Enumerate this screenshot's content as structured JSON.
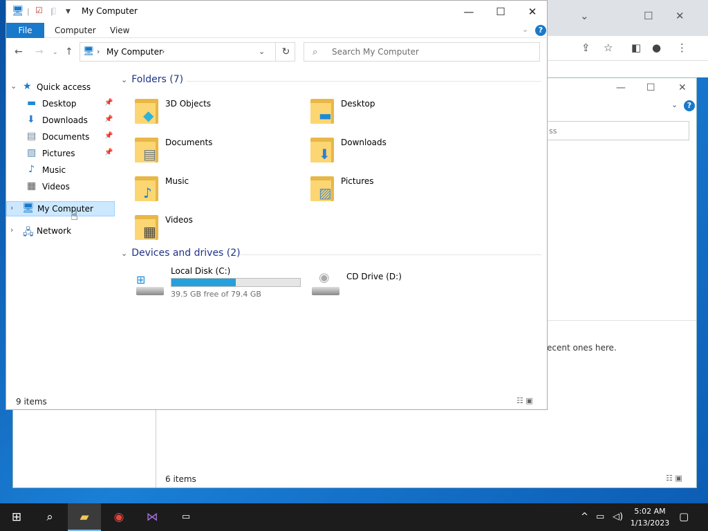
{
  "window": {
    "title": "My Computer",
    "qat_icons": [
      "computer-icon",
      "properties-icon",
      "new-folder-icon",
      "qat-dropdown-icon"
    ]
  },
  "ribbon": {
    "file": "File",
    "tabs": [
      "Computer",
      "View"
    ],
    "help": "?"
  },
  "navbar": {
    "address": "My Computer",
    "search_placeholder": "Search My Computer"
  },
  "nav": {
    "quick_access": "Quick access",
    "items": [
      {
        "label": "Desktop",
        "pinned": true
      },
      {
        "label": "Downloads",
        "pinned": true
      },
      {
        "label": "Documents",
        "pinned": true
      },
      {
        "label": "Pictures",
        "pinned": true
      },
      {
        "label": "Music",
        "pinned": false
      },
      {
        "label": "Videos",
        "pinned": false
      }
    ],
    "my_computer": "My Computer",
    "network": "Network"
  },
  "content": {
    "folders_header": "Folders (7)",
    "folders": [
      {
        "name": "3D Objects"
      },
      {
        "name": "Desktop"
      },
      {
        "name": "Documents"
      },
      {
        "name": "Downloads"
      },
      {
        "name": "Music"
      },
      {
        "name": "Pictures"
      },
      {
        "name": "Videos"
      }
    ],
    "drives_header": "Devices and drives (2)",
    "drives": [
      {
        "name": "Local Disk (C:)",
        "free": "39.5 GB free of 79.4 GB",
        "used_fraction": 0.5
      },
      {
        "name": "CD Drive (D:)"
      }
    ]
  },
  "status": {
    "items": "9 items"
  },
  "background_window": {
    "search_fragment": "ss",
    "text_fragment": "ecent ones here.",
    "status": "6 items"
  },
  "taskbar": {
    "time": "5:02 AM",
    "date": "1/13/2023"
  },
  "colors": {
    "accent": "#1979ca",
    "folder": "#fcd672",
    "drive_bar": "#26a0da",
    "selection": "#cce8ff"
  }
}
